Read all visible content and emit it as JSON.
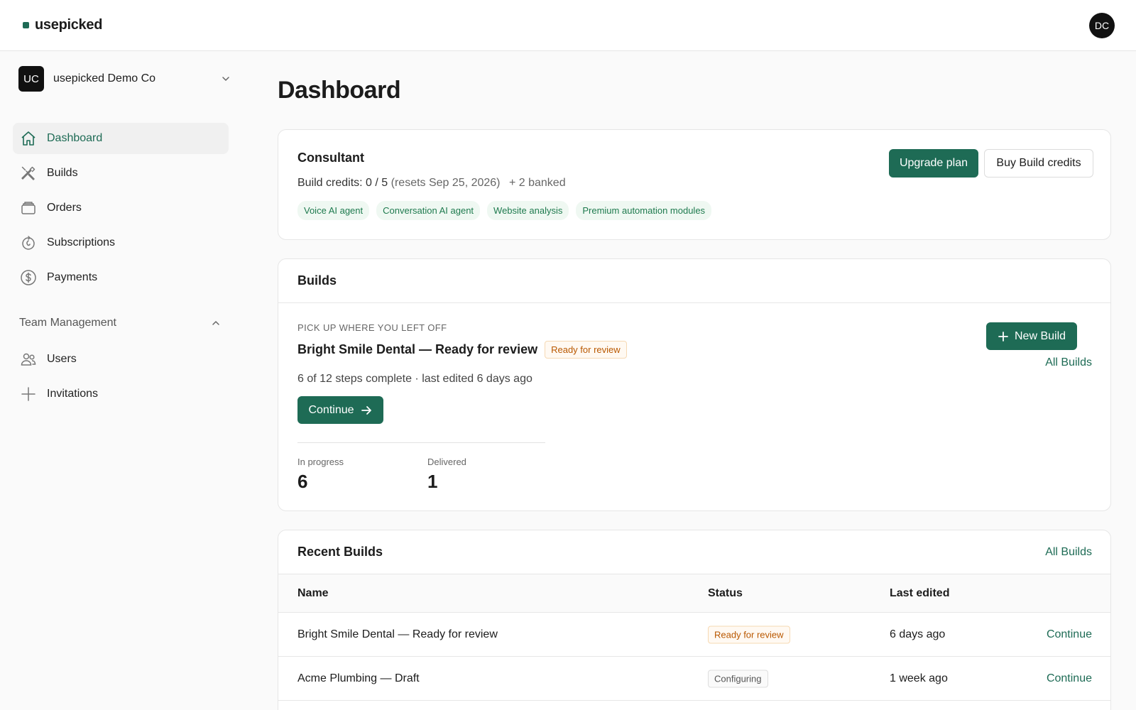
{
  "app": {
    "logo_text": "usepicked",
    "user_initials": "DC",
    "brand_color": "#1e6b55"
  },
  "sidebar": {
    "org": {
      "initials": "UC",
      "name": "usepicked Demo Co"
    },
    "items": [
      {
        "label": "Dashboard",
        "icon": "home-icon",
        "active": true
      },
      {
        "label": "Builds",
        "icon": "tools-icon"
      },
      {
        "label": "Orders",
        "icon": "box-icon"
      },
      {
        "label": "Subscriptions",
        "icon": "subscription-icon"
      },
      {
        "label": "Payments",
        "icon": "dollar-icon"
      }
    ],
    "team_section": {
      "label": "Team Management"
    },
    "team_items": [
      {
        "label": "Users",
        "icon": "users-icon"
      },
      {
        "label": "Invitations",
        "icon": "plus-icon"
      }
    ]
  },
  "main": {
    "title": "Dashboard",
    "plan": {
      "name": "Consultant",
      "credits_label": "Build credits:",
      "credits_value": "0 / 5",
      "resets": "(resets Sep 25, 2026)",
      "banked": "+ 2 banked",
      "tags": [
        "Voice AI agent",
        "Conversation AI agent",
        "Website analysis",
        "Premium automation modules"
      ],
      "upgrade_label": "Upgrade plan",
      "buy_label": "Buy Build credits"
    },
    "builds": {
      "title": "Builds",
      "kicker": "PICK UP WHERE YOU LEFT OFF",
      "current_name": "Bright Smile Dental — Ready for review",
      "current_badge": "Ready for review",
      "progress": "6 of 12 steps complete · last edited 6 days ago",
      "continue_label": "Continue",
      "stats": [
        {
          "label": "In progress",
          "value": "6"
        },
        {
          "label": "Delivered",
          "value": "1"
        }
      ],
      "new_build_label": "New Build",
      "all_builds_label": "All Builds"
    },
    "recent": {
      "title": "Recent Builds",
      "all_builds_label": "All Builds",
      "columns": [
        "Name",
        "Status",
        "Last edited"
      ],
      "rows": [
        {
          "name": "Bright Smile Dental — Ready for review",
          "status": "Ready for review",
          "edited": "6 days ago",
          "action": "Continue"
        },
        {
          "name": "Acme Plumbing — Draft",
          "status": "Configuring",
          "edited": "1 week ago",
          "action": "Continue"
        }
      ]
    }
  }
}
